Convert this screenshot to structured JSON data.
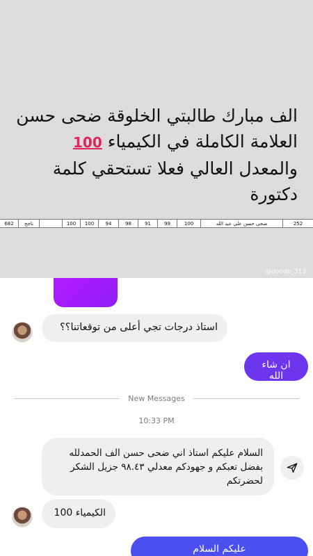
{
  "story": {
    "headline_lines": [
      "الف مبارك طالبتي الخلوقة ضحى حسن",
      "العلامة الكاملة في الكيمياء",
      "والمعدل العالي فعلا تستحقي كلمة",
      "دكتورة"
    ],
    "emoji": "100",
    "grade_row": {
      "cells": [
        "682",
        "ناجح",
        "",
        "100",
        "100",
        "94",
        "98",
        "91",
        "99",
        "100",
        "ضحى حسن علي عبد الله",
        "252"
      ]
    },
    "watermark": "@doode_313"
  },
  "chat": {
    "messages": [
      {
        "id": "m1",
        "from": "them",
        "text": "استاذ درجات تجي أعلى من توقعاتنا؟؟"
      },
      {
        "id": "m2",
        "from": "me",
        "text": "ان شاء الله"
      },
      {
        "id": "m3",
        "from": "them",
        "text": "السلام عليكم استاذ اني ضحى حسن الف الحمدلله بفضل تعبكم و جهودكم معدلي ٩٨.٤٣ جزيل الشكر لحضرتكم"
      },
      {
        "id": "m4",
        "from": "them",
        "text": "الكيمياء 100"
      },
      {
        "id": "m5",
        "from": "me",
        "text": "عليكم السلام"
      }
    ],
    "divider_label": "New Messages",
    "timestamp": "10:33 PM"
  },
  "colors": {
    "banner_bg": "#dcdcdc",
    "incoming_bubble": "#efeff1",
    "outgoing_purple": "#6c35ee",
    "outgoing_blue": "#4a4ff0",
    "story_tail": "#b41bff"
  },
  "icons": [
    "send-share-icon",
    "avatar"
  ]
}
